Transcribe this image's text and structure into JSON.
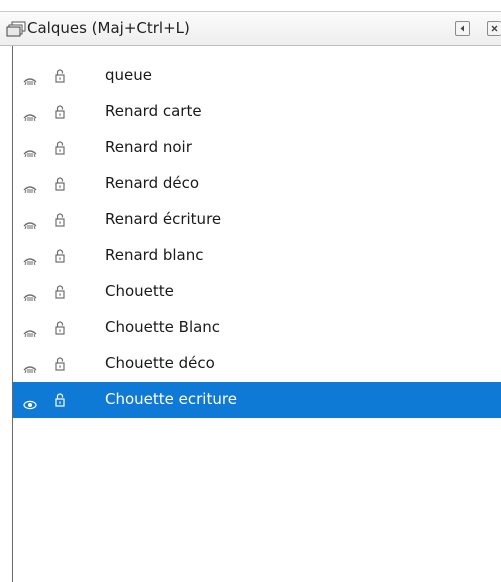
{
  "panel": {
    "title": "Calques (Maj+Ctrl+L)",
    "title_icon": "layers-icon",
    "buttons": [
      {
        "name": "collapse-button",
        "icon": "triangle-left-icon"
      },
      {
        "name": "close-button",
        "icon": "close-icon"
      }
    ]
  },
  "layers": [
    {
      "label": "queue",
      "visible_icon": "eye-icon",
      "lock_icon": "lock-icon",
      "selected": false
    },
    {
      "label": "Renard carte",
      "visible_icon": "eye-icon",
      "lock_icon": "lock-icon",
      "selected": false
    },
    {
      "label": "Renard noir",
      "visible_icon": "eye-icon",
      "lock_icon": "lock-icon",
      "selected": false
    },
    {
      "label": "Renard déco",
      "visible_icon": "eye-icon",
      "lock_icon": "lock-icon",
      "selected": false
    },
    {
      "label": "Renard écriture",
      "visible_icon": "eye-icon",
      "lock_icon": "lock-icon",
      "selected": false
    },
    {
      "label": "Renard blanc",
      "visible_icon": "eye-icon",
      "lock_icon": "lock-icon",
      "selected": false
    },
    {
      "label": "Chouette",
      "visible_icon": "eye-icon",
      "lock_icon": "lock-icon",
      "selected": false
    },
    {
      "label": "Chouette Blanc",
      "visible_icon": "eye-icon",
      "lock_icon": "lock-icon",
      "selected": false
    },
    {
      "label": "Chouette déco",
      "visible_icon": "eye-icon",
      "lock_icon": "lock-icon",
      "selected": false
    },
    {
      "label": "Chouette ecriture",
      "visible_icon": "eye-icon",
      "lock_icon": "lock-icon",
      "selected": true
    }
  ],
  "colors": {
    "selection": "#0f79d6",
    "icon_normal": "#6e6e6e",
    "icon_selected": "#ffffff"
  }
}
